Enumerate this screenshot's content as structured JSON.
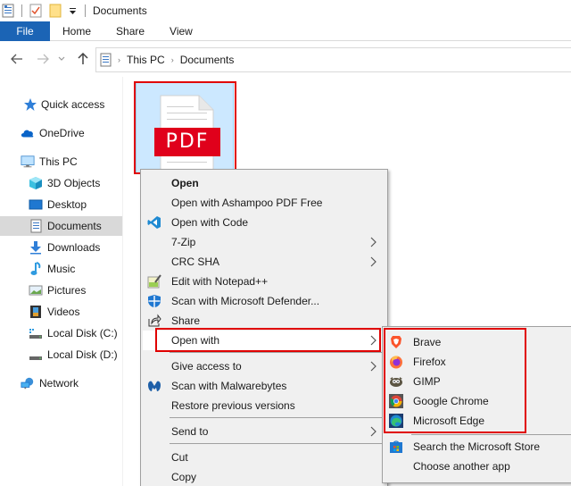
{
  "window": {
    "title": "Documents",
    "quick_access_toolbar": [
      "properties-icon",
      "new-folder-icon",
      "customize-dropdown"
    ]
  },
  "ribbon": {
    "tabs": [
      {
        "label": "File",
        "active": true
      },
      {
        "label": "Home"
      },
      {
        "label": "Share"
      },
      {
        "label": "View"
      }
    ]
  },
  "address": {
    "breadcrumb": [
      "This PC",
      "Documents"
    ]
  },
  "nav_pane": {
    "items": [
      {
        "label": "Quick access",
        "icon": "star-icon"
      },
      {
        "label": "OneDrive",
        "icon": "cloud-icon"
      },
      {
        "label": "This PC",
        "icon": "computer-icon"
      },
      {
        "label": "3D Objects",
        "icon": "cube-icon"
      },
      {
        "label": "Desktop",
        "icon": "desktop-icon"
      },
      {
        "label": "Documents",
        "icon": "document-icon",
        "selected": true
      },
      {
        "label": "Downloads",
        "icon": "download-icon"
      },
      {
        "label": "Music",
        "icon": "music-icon"
      },
      {
        "label": "Pictures",
        "icon": "pictures-icon"
      },
      {
        "label": "Videos",
        "icon": "videos-icon"
      },
      {
        "label": "Local Disk (C:)",
        "icon": "drive-icon"
      },
      {
        "label": "Local Disk (D:)",
        "icon": "drive-icon"
      },
      {
        "label": "Network",
        "icon": "network-icon"
      }
    ]
  },
  "file": {
    "badge": "PDF",
    "badge_color": "#e0001b"
  },
  "context_menu": {
    "items": [
      {
        "label": "Open",
        "bold": true
      },
      {
        "label": "Open with Ashampoo PDF Free"
      },
      {
        "label": "Open with Code",
        "icon": "vscode-icon"
      },
      {
        "label": "7-Zip",
        "submenu": true
      },
      {
        "label": "CRC SHA",
        "submenu": true
      },
      {
        "label": "Edit with Notepad++",
        "icon": "notepadpp-icon"
      },
      {
        "label": "Scan with Microsoft Defender...",
        "icon": "defender-icon"
      },
      {
        "label": "Share",
        "icon": "share-icon"
      },
      {
        "label": "Open with",
        "submenu": true,
        "highlighted": true
      },
      {
        "label": "Give access to",
        "submenu": true
      },
      {
        "label": "Scan with Malwarebytes",
        "icon": "malwarebytes-icon"
      },
      {
        "label": "Restore previous versions"
      },
      {
        "label": "Send to",
        "submenu": true
      },
      {
        "label": "Cut"
      },
      {
        "label": "Copy"
      }
    ]
  },
  "open_with_submenu": {
    "items": [
      {
        "label": "Brave",
        "icon": "brave-icon"
      },
      {
        "label": "Firefox",
        "icon": "firefox-icon"
      },
      {
        "label": "GIMP",
        "icon": "gimp-icon"
      },
      {
        "label": "Google Chrome",
        "icon": "chrome-icon"
      },
      {
        "label": "Microsoft Edge",
        "icon": "edge-icon"
      },
      {
        "label": "Search the Microsoft Store",
        "icon": "store-icon"
      },
      {
        "label": "Choose another app"
      }
    ]
  },
  "colors": {
    "accent": "#1b64b5",
    "selection": "#cce8ff",
    "annotation": "#e00000"
  }
}
